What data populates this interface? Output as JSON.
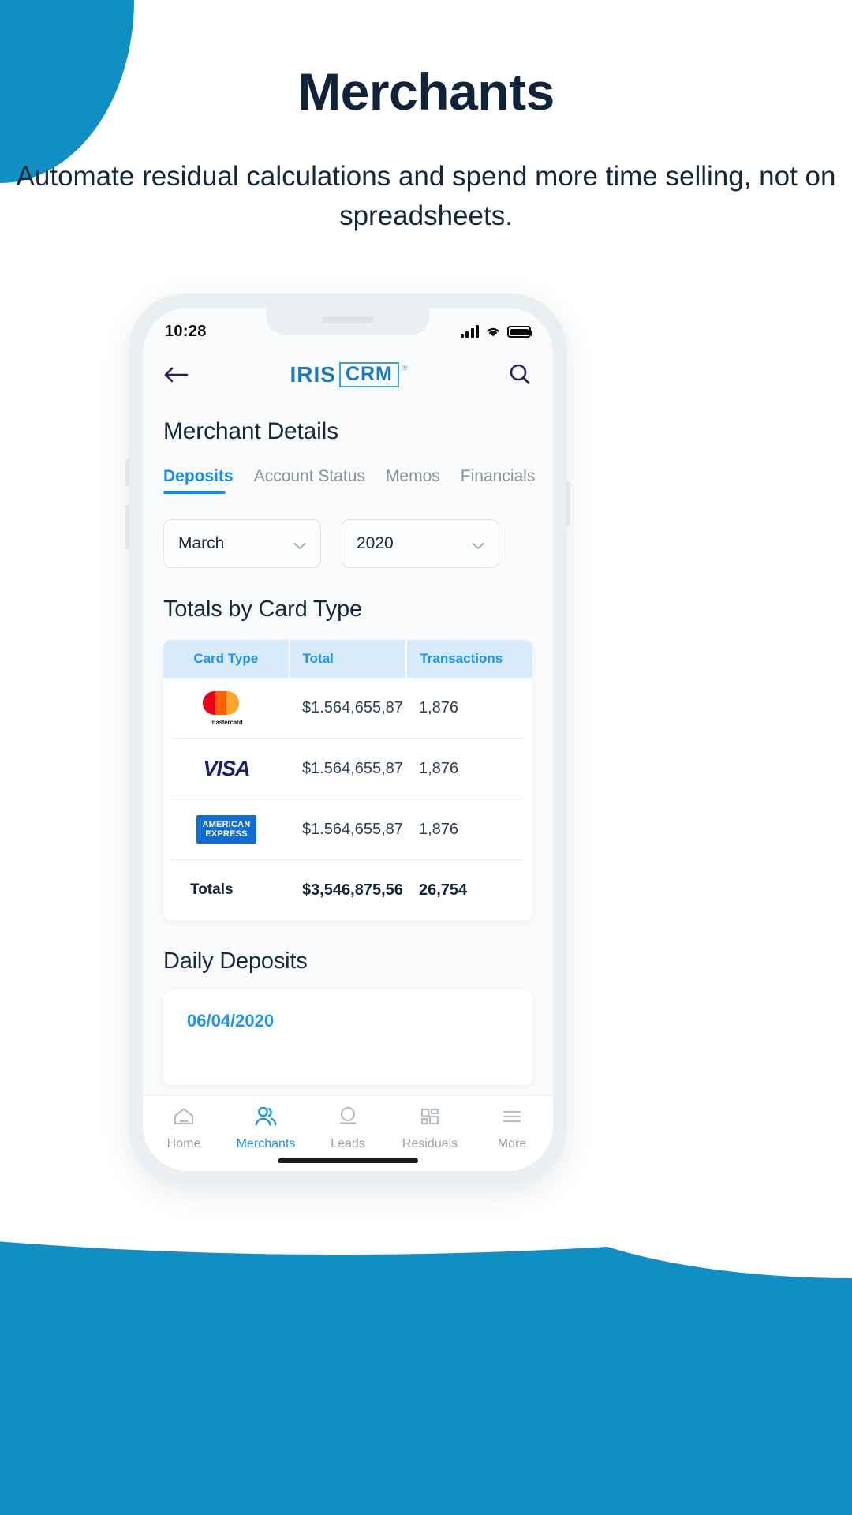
{
  "hero": {
    "title": "Merchants",
    "subtitle": "Automate residual calculations and spend more time selling, not on spreadsheets."
  },
  "colors": {
    "brand_blue": "#0f8fc4",
    "accent_blue": "#1d94ee",
    "logo_blue": "#1878bd",
    "table_header_bg": "#d7ebfb",
    "text_dark": "#14283d"
  },
  "phone": {
    "statusbar": {
      "time": "10:28",
      "icons": [
        "signal-icon",
        "wifi-icon",
        "battery-icon"
      ]
    },
    "header": {
      "back_icon": "arrow-left-icon",
      "logo_primary": "IRIS",
      "logo_secondary": "CRM",
      "logo_registered": "®",
      "search_icon": "search-icon"
    },
    "screen": {
      "detail_title": "Merchant Details",
      "tabs": [
        {
          "label": "Deposits",
          "active": true
        },
        {
          "label": "Account Status",
          "active": false
        },
        {
          "label": "Memos",
          "active": false
        },
        {
          "label": "Financials",
          "active": false
        }
      ],
      "filters": [
        {
          "name": "month-select",
          "value": "March",
          "icon": "chevron-down-icon"
        },
        {
          "name": "year-select",
          "value": "2020",
          "icon": "chevron-down-icon"
        }
      ],
      "totals_section": {
        "title": "Totals by Card Type",
        "columns": [
          "Card Type",
          "Total",
          "Transactions"
        ],
        "rows": [
          {
            "card": "mastercard-logo",
            "card_label": "mastercard",
            "total": "$1.564,655,87",
            "transactions": "1,876"
          },
          {
            "card": "visa-logo",
            "card_label": "VISA",
            "total": "$1.564,655,87",
            "transactions": "1,876"
          },
          {
            "card": "amex-logo",
            "card_label": "AMERICAN EXPRESS",
            "total": "$1.564,655,87",
            "transactions": "1,876"
          }
        ],
        "totals_row": {
          "label": "Totals",
          "total": "$3,546,875,56",
          "transactions": "26,754"
        }
      },
      "daily_section": {
        "title": "Daily Deposits",
        "first_date": "06/04/2020"
      }
    },
    "bottom_nav": [
      {
        "label": "Home",
        "icon": "home-icon",
        "active": false
      },
      {
        "label": "Merchants",
        "icon": "people-icon",
        "active": true
      },
      {
        "label": "Leads",
        "icon": "lead-icon",
        "active": false
      },
      {
        "label": "Residuals",
        "icon": "grid-icon",
        "active": false
      },
      {
        "label": "More",
        "icon": "menu-icon",
        "active": false
      }
    ]
  }
}
